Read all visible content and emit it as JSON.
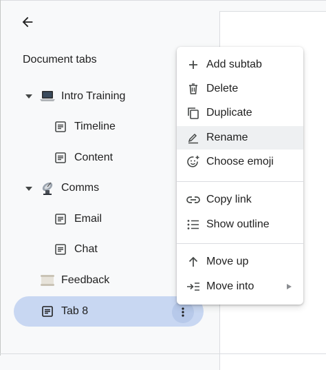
{
  "panel": {
    "title": "Document tabs"
  },
  "tabs": [
    {
      "label": "Intro Training",
      "icon": "laptop-emoji-icon",
      "expanded": true
    },
    {
      "label": "Timeline",
      "icon": "document-icon",
      "child": true
    },
    {
      "label": "Content",
      "icon": "document-icon",
      "child": true
    },
    {
      "label": "Comms",
      "icon": "satellite-emoji-icon",
      "expanded": true
    },
    {
      "label": "Email",
      "icon": "document-icon",
      "child": true
    },
    {
      "label": "Chat",
      "icon": "document-icon",
      "child": true
    },
    {
      "label": "Feedback",
      "icon": "scroll-emoji-icon"
    },
    {
      "label": "Tab 8",
      "icon": "document-icon",
      "selected": true
    }
  ],
  "menu": {
    "items": [
      {
        "label": "Add subtab",
        "icon": "plus-icon"
      },
      {
        "label": "Delete",
        "icon": "trash-icon"
      },
      {
        "label": "Duplicate",
        "icon": "duplicate-icon"
      },
      {
        "label": "Rename",
        "icon": "pencil-icon",
        "hover": true
      },
      {
        "label": "Choose emoji",
        "icon": "emoji-add-icon"
      },
      {
        "label": "Copy link",
        "icon": "link-icon"
      },
      {
        "label": "Show outline",
        "icon": "list-outline-icon"
      },
      {
        "label": "Move up",
        "icon": "arrow-up-icon"
      },
      {
        "label": "Move into",
        "icon": "move-into-icon",
        "has_submenu": true
      }
    ]
  },
  "colors": {
    "selected_bg": "#c8d7f2",
    "kebab_bg": "#b7c9ea",
    "menu_hover": "#eef0f2",
    "text": "#1f1f1f",
    "icon": "#444746"
  }
}
